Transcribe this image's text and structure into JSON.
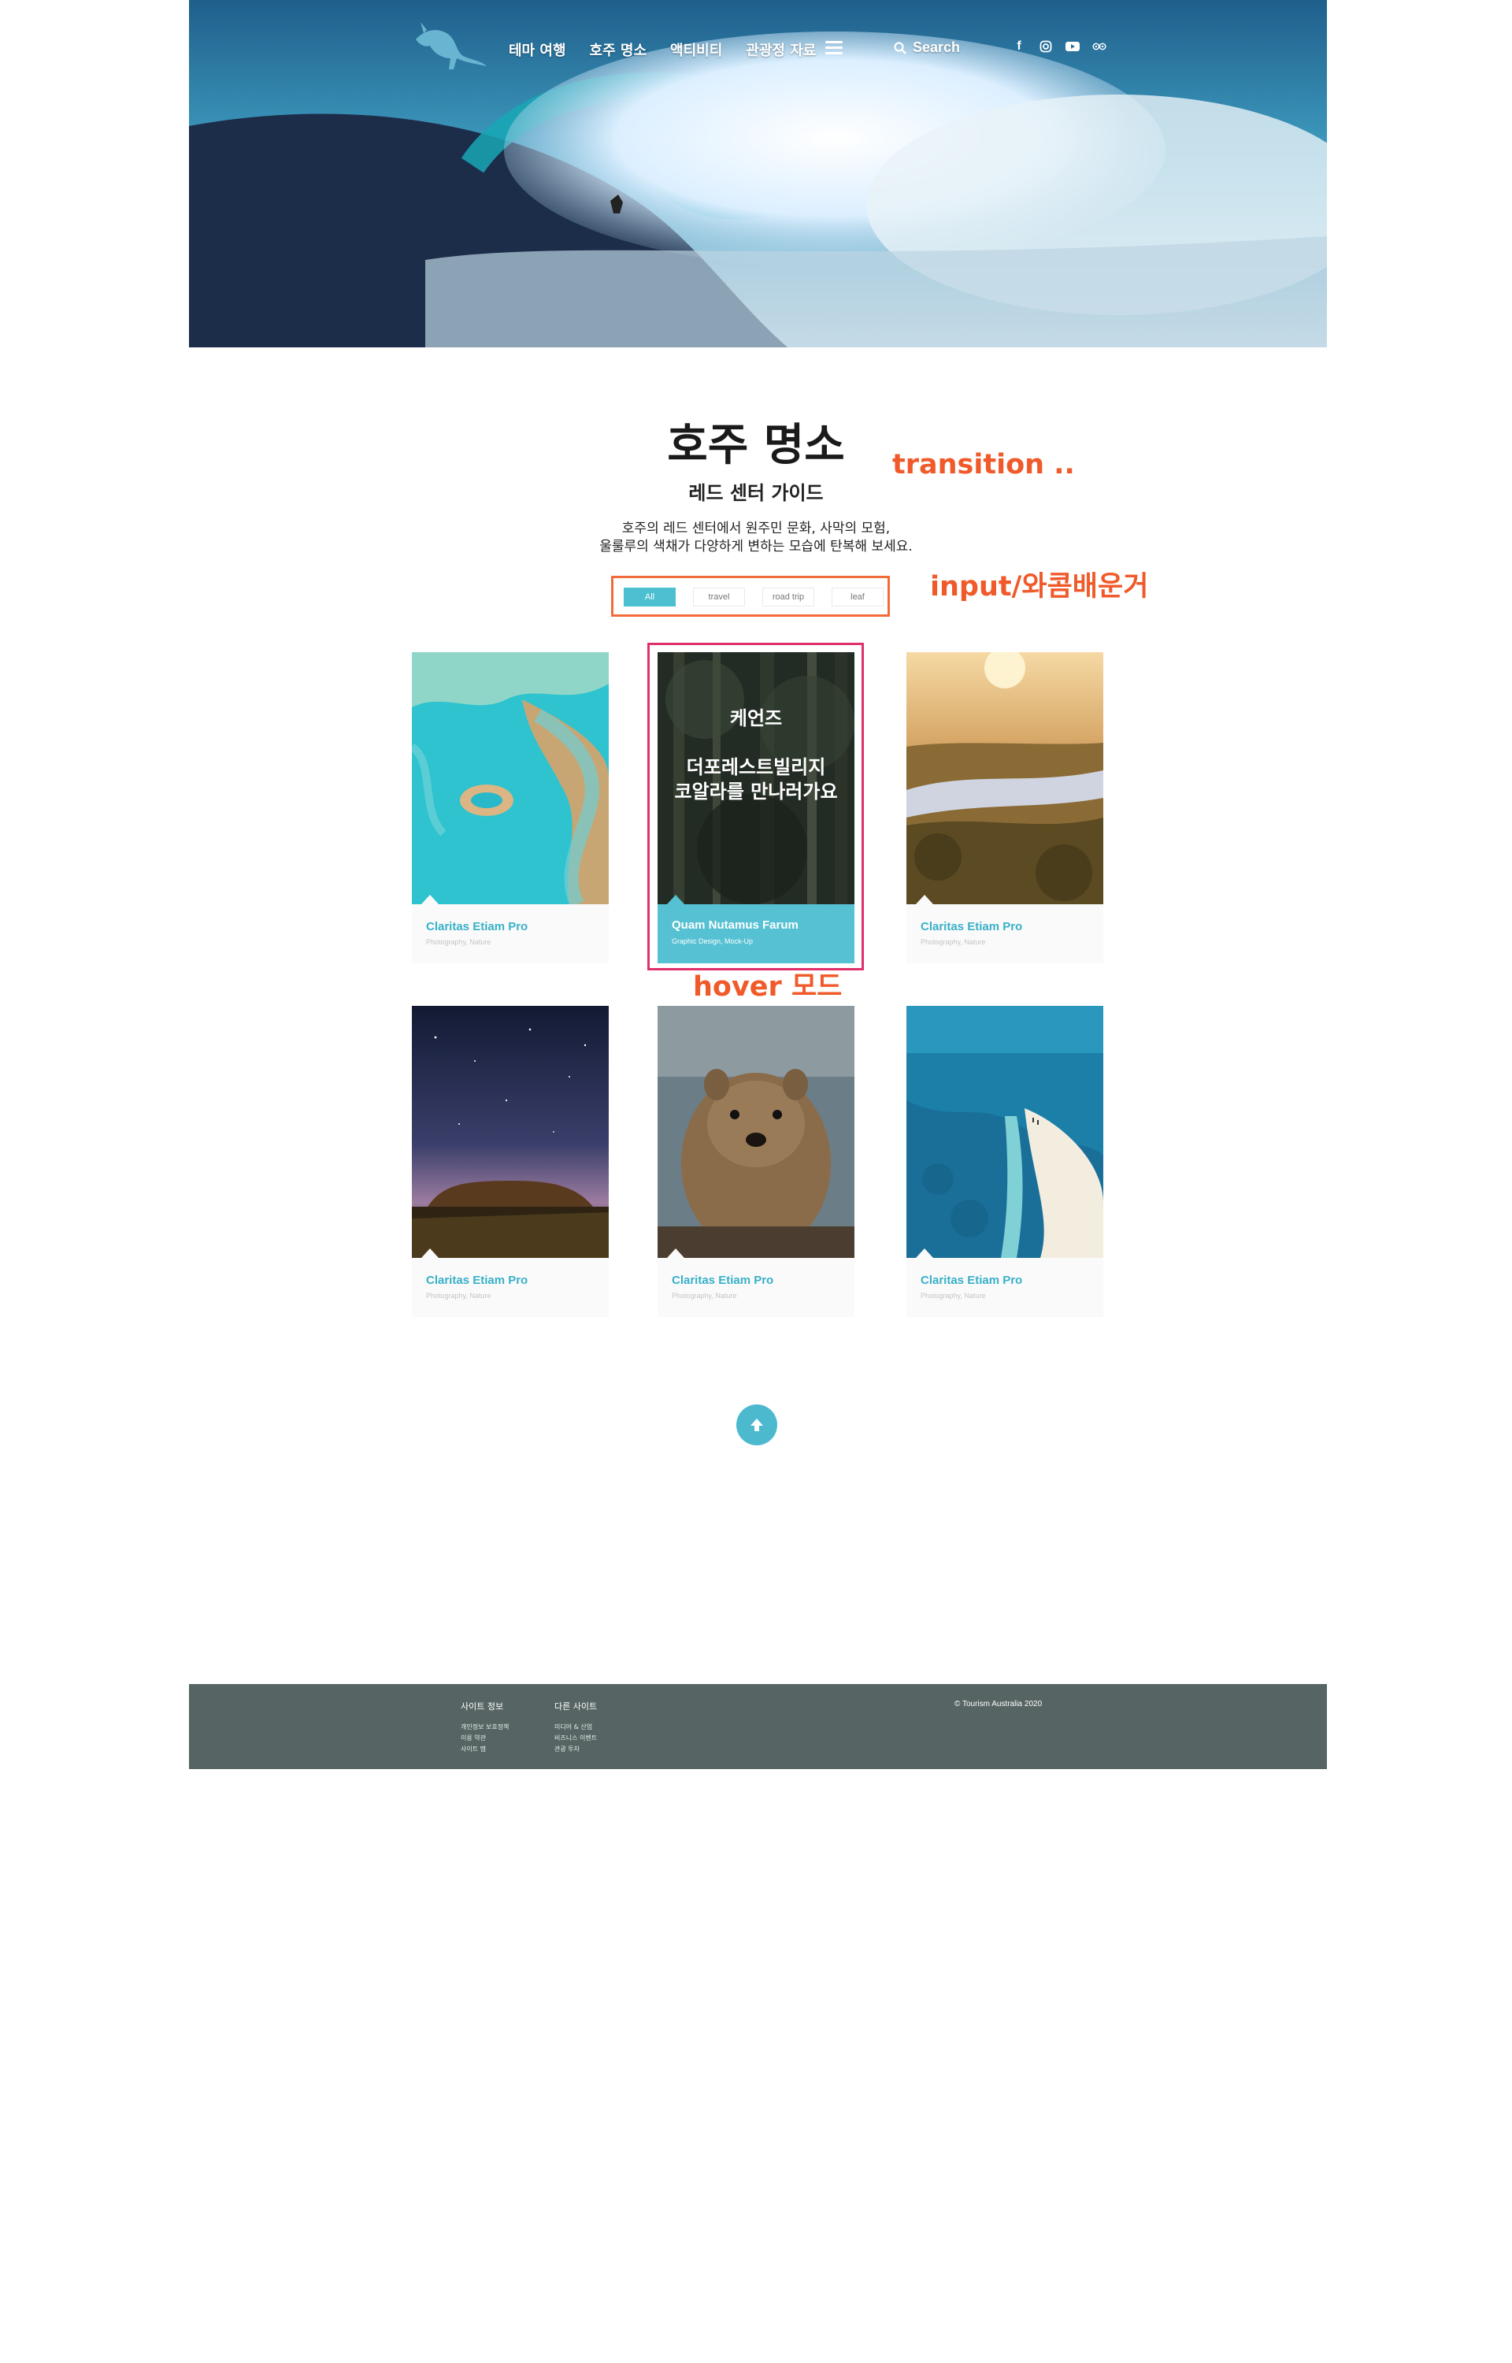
{
  "header": {
    "nav": [
      "테마 여행",
      "호주 명소",
      "액티비티",
      "관광정 자료"
    ],
    "search_label": "Search",
    "social_icons": [
      "facebook-icon",
      "instagram-icon",
      "youtube-icon",
      "tripadvisor-icon"
    ]
  },
  "intro": {
    "title": "호주 명소",
    "subtitle": "레드 센터 가이드",
    "description": [
      "호주의 레드 센터에서 원주민 문화, 사막의 모험,",
      "울룰루의 색채가 다양하게 변하는 모습에 탄복해 보세요."
    ]
  },
  "annotations": {
    "transition": "transition ..",
    "input": "input/와콤배운거",
    "hover": "hover 모드"
  },
  "filters": [
    "All",
    "travel",
    "road trip",
    "leaf"
  ],
  "active_filter": "All",
  "cards": [
    {
      "title": "Claritas Etiam Pro",
      "category": "Photography, Nature",
      "image": "reef-heart"
    },
    {
      "title": "Quam Nutamus Farum",
      "category": "Graphic Design, Mock-Up",
      "image": "rainforest",
      "hover": true,
      "overlay": {
        "location": "케언즈",
        "line1": "더포레스트빌리지",
        "line2": "코알라를 만나러가요"
      }
    },
    {
      "title": "Claritas Etiam Pro",
      "category": "Photography, Nature",
      "image": "river-sunrise"
    },
    {
      "title": "Claritas Etiam Pro",
      "category": "Photography, Nature",
      "image": "uluru-night"
    },
    {
      "title": "Claritas Etiam Pro",
      "category": "Photography, Nature",
      "image": "quokka"
    },
    {
      "title": "Claritas Etiam Pro",
      "category": "Photography, Nature",
      "image": "beach-sandbar"
    }
  ],
  "footer": {
    "col1": {
      "heading": "사이트 정보",
      "links": [
        "개인정보 보호정책",
        "이용 약관",
        "사이트 맵"
      ]
    },
    "col2": {
      "heading": "다른 사이트",
      "links": [
        "미디어 & 산업",
        "비즈니스 이벤트",
        "관광 투자"
      ]
    },
    "copyright": "© Tourism Australia 2020"
  },
  "colors": {
    "accent": "#4cbfd1",
    "annotation": "#f05a2a",
    "hover_border": "#e0306a",
    "footer": "#566563"
  }
}
